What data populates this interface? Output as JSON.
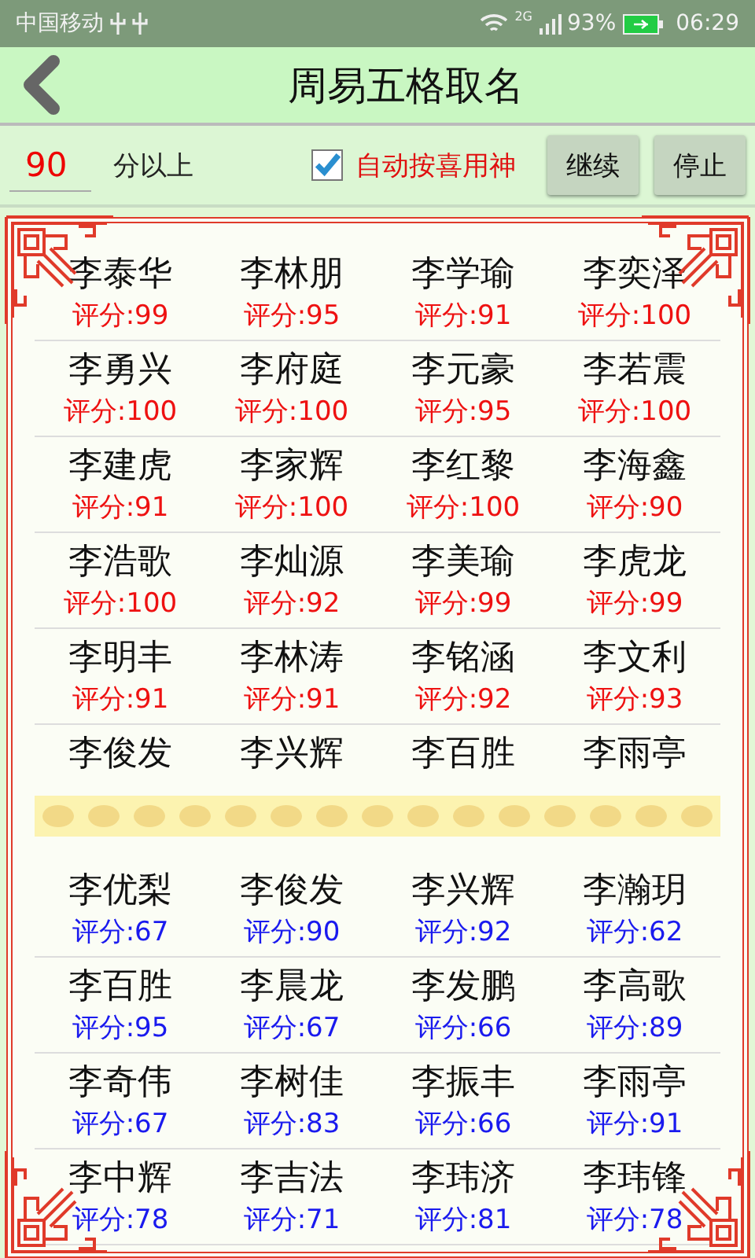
{
  "status_bar": {
    "carrier": "中国移动",
    "network": "2G",
    "battery": "93%",
    "time": "06:29"
  },
  "header": {
    "title": "周易五格取名"
  },
  "filter": {
    "min_score": "90",
    "min_score_suffix": "分以上",
    "auto_label": "自动按喜用神",
    "auto_checked": true,
    "buttons": [
      "继续",
      "停止"
    ]
  },
  "groups": [
    {
      "color": "#ee1111",
      "rows": [
        [
          {
            "name": "李泰华",
            "score": "评分:99"
          },
          {
            "name": "李林朋",
            "score": "评分:95"
          },
          {
            "name": "李学瑜",
            "score": "评分:91"
          },
          {
            "name": "李奕泽",
            "score": "评分:100"
          }
        ],
        [
          {
            "name": "李勇兴",
            "score": "评分:100"
          },
          {
            "name": "李府庭",
            "score": "评分:100"
          },
          {
            "name": "李元豪",
            "score": "评分:95"
          },
          {
            "name": "李若震",
            "score": "评分:100"
          }
        ],
        [
          {
            "name": "李建虎",
            "score": "评分:91"
          },
          {
            "name": "李家辉",
            "score": "评分:100"
          },
          {
            "name": "李红黎",
            "score": "评分:100"
          },
          {
            "name": "李海鑫",
            "score": "评分:90"
          }
        ],
        [
          {
            "name": "李浩歌",
            "score": "评分:100"
          },
          {
            "name": "李灿源",
            "score": "评分:92"
          },
          {
            "name": "李美瑜",
            "score": "评分:99"
          },
          {
            "name": "李虎龙",
            "score": "评分:99"
          }
        ],
        [
          {
            "name": "李明丰",
            "score": "评分:91"
          },
          {
            "name": "李林涛",
            "score": "评分:91"
          },
          {
            "name": "李铭涵",
            "score": "评分:92"
          },
          {
            "name": "李文利",
            "score": "评分:93"
          }
        ],
        [
          {
            "name": "李俊发"
          },
          {
            "name": "李兴辉"
          },
          {
            "name": "李百胜"
          },
          {
            "name": "李雨亭"
          }
        ]
      ]
    },
    {
      "color": "#1a1aee",
      "rows": [
        [
          {
            "name": "李优梨",
            "score": "评分:67"
          },
          {
            "name": "李俊发",
            "score": "评分:90"
          },
          {
            "name": "李兴辉",
            "score": "评分:92"
          },
          {
            "name": "李瀚玥",
            "score": "评分:62"
          }
        ],
        [
          {
            "name": "李百胜",
            "score": "评分:95"
          },
          {
            "name": "李晨龙",
            "score": "评分:67"
          },
          {
            "name": "李发鹏",
            "score": "评分:66"
          },
          {
            "name": "李高歌",
            "score": "评分:89"
          }
        ],
        [
          {
            "name": "李奇伟",
            "score": "评分:67"
          },
          {
            "name": "李树佳",
            "score": "评分:83"
          },
          {
            "name": "李振丰",
            "score": "评分:66"
          },
          {
            "name": "李雨亭",
            "score": "评分:91"
          }
        ],
        [
          {
            "name": "李中辉",
            "score": "评分:78"
          },
          {
            "name": "李吉法",
            "score": "评分:71"
          },
          {
            "name": "李玮济",
            "score": "评分:81"
          },
          {
            "name": "李玮锋",
            "score": "评分:78"
          }
        ]
      ]
    }
  ]
}
